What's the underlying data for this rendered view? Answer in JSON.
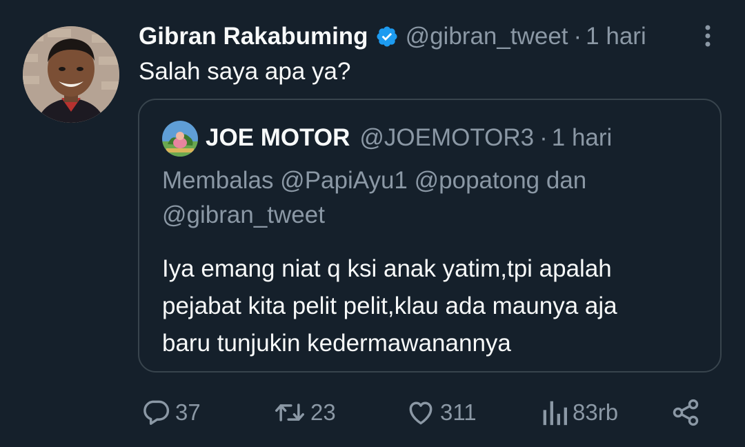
{
  "author": {
    "name": "Gibran Rakabuming",
    "handle": "@gibran_tweet",
    "separator": "·",
    "time": "1 hari",
    "verified": true
  },
  "tweet_text": "Salah saya apa ya?",
  "quoted": {
    "name": "JOE MOTOR",
    "handle": "@JOEMOTOR3",
    "separator": "·",
    "time": "1 hari",
    "reply_line_1": "Membalas @PapiAyu1 @popatong dan",
    "reply_line_2": "@gibran_tweet",
    "body_lines": [
      "Iya emang niat q ksi anak yatim,tpi apalah",
      "pejabat kita pelit pelit,klau ada maunya aja",
      "baru tunjukin kedermawanannya"
    ]
  },
  "actions": {
    "replies": "37",
    "retweets": "23",
    "likes": "311",
    "views": "83rb"
  },
  "icons": {
    "verified": "verified-badge-icon",
    "more": "more-vertical-icon",
    "reply": "reply-icon",
    "retweet": "retweet-icon",
    "like": "heart-icon",
    "views": "views-chart-icon",
    "share": "share-icon"
  },
  "colors": {
    "background": "#15202b",
    "text": "#f7f9f9",
    "secondary": "#8b98a5",
    "verified": "#1d9bf0",
    "border": "#38444d"
  }
}
